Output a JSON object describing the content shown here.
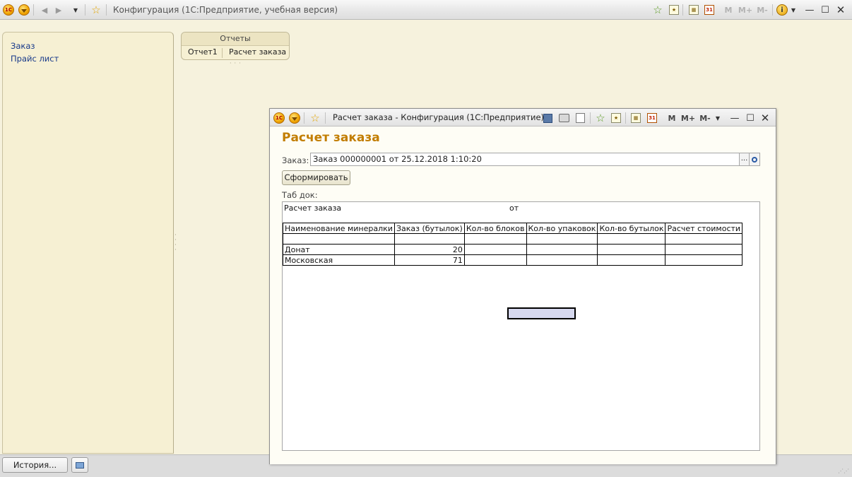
{
  "app": {
    "title": "Конфигурация  (1С:Предприятие, учебная версия)",
    "logo_text": "1С",
    "toolbar_m": [
      "M",
      "M+",
      "M-"
    ],
    "colors": {
      "background": "#f6f2dd",
      "accent": "#c27d00",
      "link": "#17398a"
    }
  },
  "sidebar": {
    "items": [
      {
        "label": "Заказ"
      },
      {
        "label": "Прайс лист"
      }
    ]
  },
  "reports": {
    "header": "Отчеты",
    "items": [
      {
        "label": "Отчет1"
      },
      {
        "label": "Расчет заказа"
      }
    ]
  },
  "status": {
    "history_label": "История..."
  },
  "child": {
    "title": "Расчет заказа - Конфигурация  (1С:Предприятие)",
    "logo_text": "1С",
    "calendar_day": "31",
    "toolbar_m": [
      "M",
      "M+",
      "M-"
    ],
    "form": {
      "title": "Расчет заказа",
      "order_label": "Заказ:",
      "order_value": "Заказ 000000001 от 25.12.2018 1:10:20",
      "select_label": "...",
      "generate_label": "Сформировать",
      "tab_label": "Таб док:"
    },
    "report": {
      "title": "Расчет заказа",
      "from_label": "от",
      "columns": [
        "Наименование минералки",
        "Заказ (бутылок)",
        "Кол-во блоков",
        "Кол-во упаковок",
        "Кол-во бутылок",
        "Расчет стоимости"
      ],
      "rows": [
        [
          "",
          "",
          "",
          "",
          "",
          ""
        ],
        [
          "Донат",
          "20",
          "",
          "",
          "",
          ""
        ],
        [
          "Московская",
          "71",
          "",
          "",
          "",
          ""
        ]
      ]
    }
  }
}
